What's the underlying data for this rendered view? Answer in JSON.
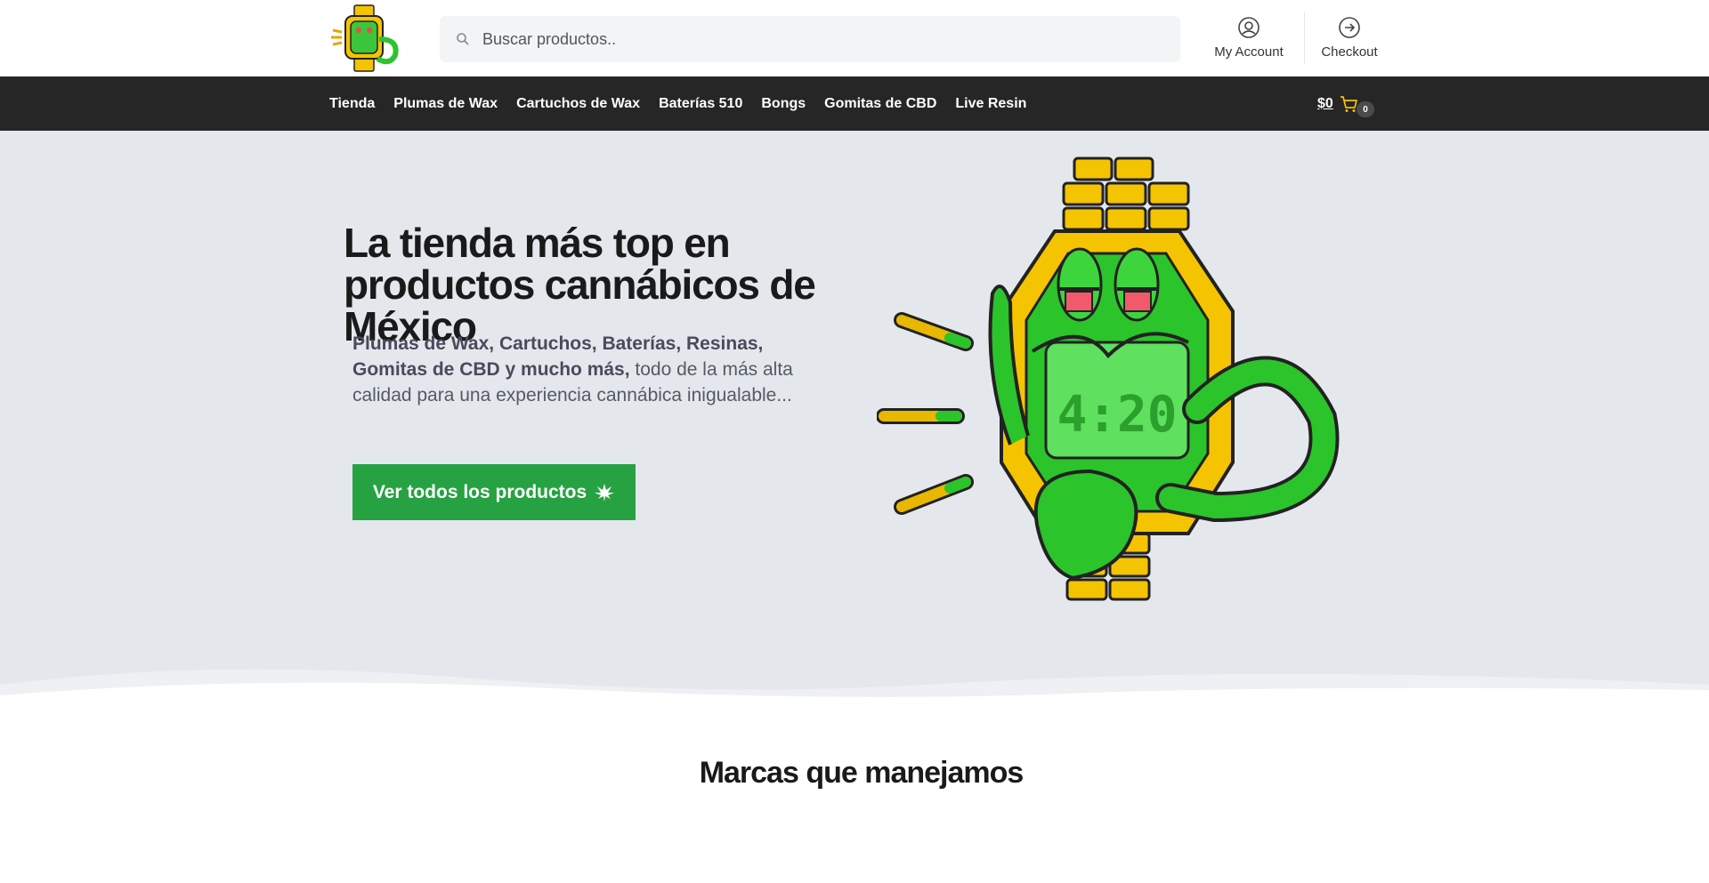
{
  "search": {
    "placeholder": "Buscar productos.."
  },
  "header": {
    "account_label": "My Account",
    "checkout_label": "Checkout"
  },
  "nav": {
    "items": [
      "Tienda",
      "Plumas de Wax",
      "Cartuchos de Wax",
      "Baterías 510",
      "Bongs",
      "Gomitas de CBD",
      "Live Resin"
    ]
  },
  "cart": {
    "total": "$0",
    "count": "0"
  },
  "hero": {
    "title": "La tienda más top en productos cannábicos de México",
    "text_bold": "Plumas de Wax, Cartuchos, Baterías, Resinas, Gomitas de CBD y mucho más,",
    "text_rest": " todo de la más alta calidad para una experiencia cannábica inigualable...",
    "cta_label": "Ver todos los productos",
    "watch_display": "4:20"
  },
  "brands": {
    "title": "Marcas que manejamos"
  },
  "icons": {
    "search": "search-icon",
    "account": "user-circle-icon",
    "checkout": "arrow-right-circle-icon",
    "cart": "cart-icon",
    "cta": "cannabis-leaf-icon",
    "logo": "watch-mascot-logo"
  },
  "colors": {
    "nav_bg": "#262626",
    "hero_bg": "#e4e7ec",
    "cta_bg": "#27a243",
    "mascot_green": "#2bc42b",
    "mascot_gold": "#f5c400"
  }
}
